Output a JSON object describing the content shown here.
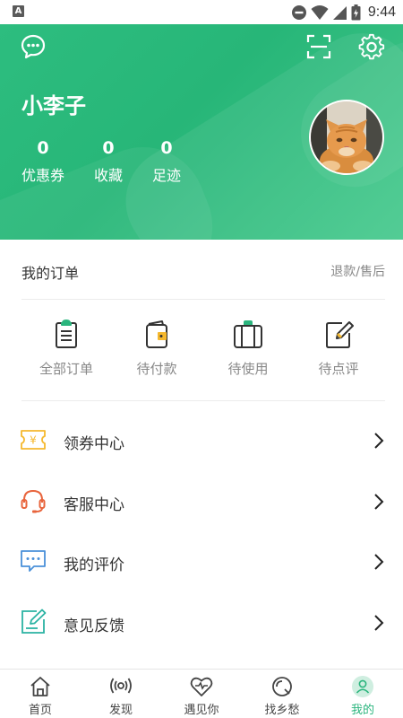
{
  "status_bar": {
    "badge": "A",
    "time": "9:44"
  },
  "header": {
    "username": "小李子",
    "stats": [
      {
        "value": "0",
        "label": "优惠券"
      },
      {
        "value": "0",
        "label": "收藏"
      },
      {
        "value": "0",
        "label": "足迹"
      }
    ],
    "icons": [
      "message-icon",
      "scan-icon",
      "settings-icon"
    ]
  },
  "orders": {
    "title": "我的订单",
    "link": "退款/售后",
    "items": [
      {
        "label": "全部订单",
        "icon": "clipboard-icon"
      },
      {
        "label": "待付款",
        "icon": "wallet-icon"
      },
      {
        "label": "待使用",
        "icon": "briefcase-icon"
      },
      {
        "label": "待点评",
        "icon": "edit-icon"
      }
    ]
  },
  "menu": [
    {
      "label": "领券中心",
      "icon": "coupon-icon",
      "color": "#f5b82e"
    },
    {
      "label": "客服中心",
      "icon": "headset-icon",
      "color": "#e8643c"
    },
    {
      "label": "我的评价",
      "icon": "comment-icon",
      "color": "#4a90d9"
    },
    {
      "label": "意见反馈",
      "icon": "feedback-icon",
      "color": "#2bb3a3"
    }
  ],
  "tabs": [
    {
      "label": "首页",
      "icon": "home-icon"
    },
    {
      "label": "发现",
      "icon": "discover-icon"
    },
    {
      "label": "遇见你",
      "icon": "heart-icon"
    },
    {
      "label": "找乡愁",
      "icon": "search-circle-icon"
    },
    {
      "label": "我的",
      "icon": "user-icon",
      "active": true
    }
  ],
  "colors": {
    "brand": "#2ab57d",
    "text": "#333333",
    "muted": "#888888"
  }
}
